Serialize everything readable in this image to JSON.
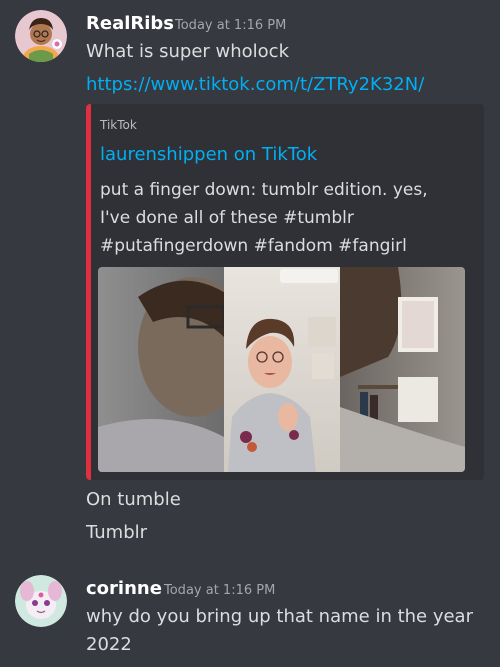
{
  "messages": [
    {
      "username": "RealRibs",
      "timestamp": "Today at 1:16 PM",
      "text": "What is super wholock",
      "link": "https://www.tiktok.com/t/ZTRy2K32N/",
      "embed": {
        "provider": "TikTok",
        "author": "laurenshippen on TikTok",
        "description_lines": [
          "put a finger down: tumblr edition. yes,",
          "I've done all of these #tumblr",
          "#putafingerdown #fandom #fangirl"
        ]
      },
      "followups": [
        "On tumble",
        "Tumblr"
      ]
    },
    {
      "username": "corinne",
      "timestamp": "Today at 1:16 PM",
      "text_lines": [
        "why do you bring up that name in the year",
        "2022"
      ]
    }
  ],
  "colors": {
    "background": "#36393f",
    "embed_background": "#2f3136",
    "embed_accent": "#e0303f",
    "link": "#00aff4",
    "username": "#ffffff",
    "text": "#dcddde",
    "timestamp": "#a3a6aa"
  }
}
